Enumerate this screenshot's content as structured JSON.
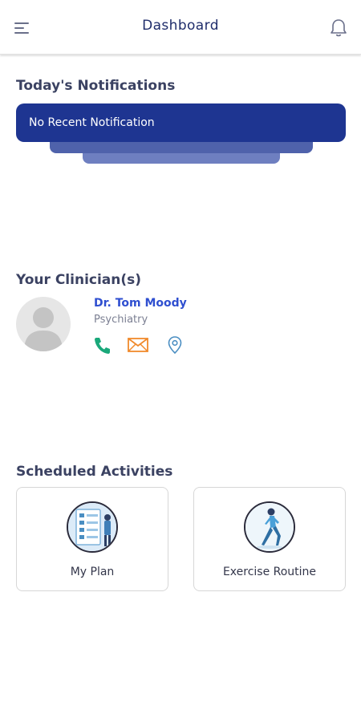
{
  "header": {
    "title": "Dashboard",
    "menu_icon": "hamburger-menu-icon",
    "notification_icon": "bell-icon"
  },
  "notifications": {
    "section_title": "Today's Notifications",
    "message": "No Recent Notification"
  },
  "clinicians": {
    "section_title": "Your Clinician(s)",
    "items": [
      {
        "name": "Dr. Tom Moody",
        "specialty": "Psychiatry",
        "actions": [
          "phone-icon",
          "mail-icon",
          "location-pin-icon"
        ]
      }
    ]
  },
  "activities": {
    "section_title": "Scheduled Activities",
    "items": [
      {
        "label": "My Plan",
        "icon": "plan-checklist-icon"
      },
      {
        "label": "Exercise Routine",
        "icon": "exercise-runner-icon"
      }
    ]
  },
  "colors": {
    "primary": "#1e3591",
    "accent_link": "#2f4fd0",
    "phone": "#1aa87a",
    "mail": "#f08a2c",
    "location": "#4a8ec2"
  }
}
